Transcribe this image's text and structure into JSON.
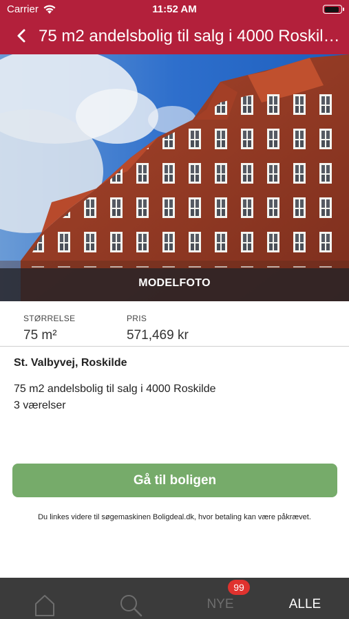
{
  "status_bar": {
    "carrier": "Carrier",
    "time": "11:52 AM",
    "battery_level": 0.95
  },
  "nav": {
    "title": "75 m2 andelsbolig til salg i 4000 Roskilde",
    "back_icon": "chevron-left-icon",
    "background_color": "#b3203b"
  },
  "hero": {
    "overlay_label": "MODELFOTO"
  },
  "facts": {
    "size_label": "STØRRELSE",
    "size_value": "75 m²",
    "price_label": "PRIS",
    "price_value": "571,469 kr"
  },
  "listing": {
    "address": "St. Valbyvej, Roskilde",
    "description": "75 m2 andelsbolig til salg i 4000 Roskilde",
    "rooms": "3 værelser"
  },
  "cta": {
    "label": "Gå til boligen",
    "color": "#76ab6a"
  },
  "disclaimer": "Du linkes videre til søgemaskinen Boligdeal.dk, hvor betaling kan være påkrævet.",
  "tabbar": {
    "tabs": [
      {
        "icon": "home-icon",
        "label": ""
      },
      {
        "icon": "search-icon",
        "label": ""
      },
      {
        "label": "NYE",
        "badge": "99"
      },
      {
        "label": "ALLE",
        "selected": true
      }
    ]
  }
}
